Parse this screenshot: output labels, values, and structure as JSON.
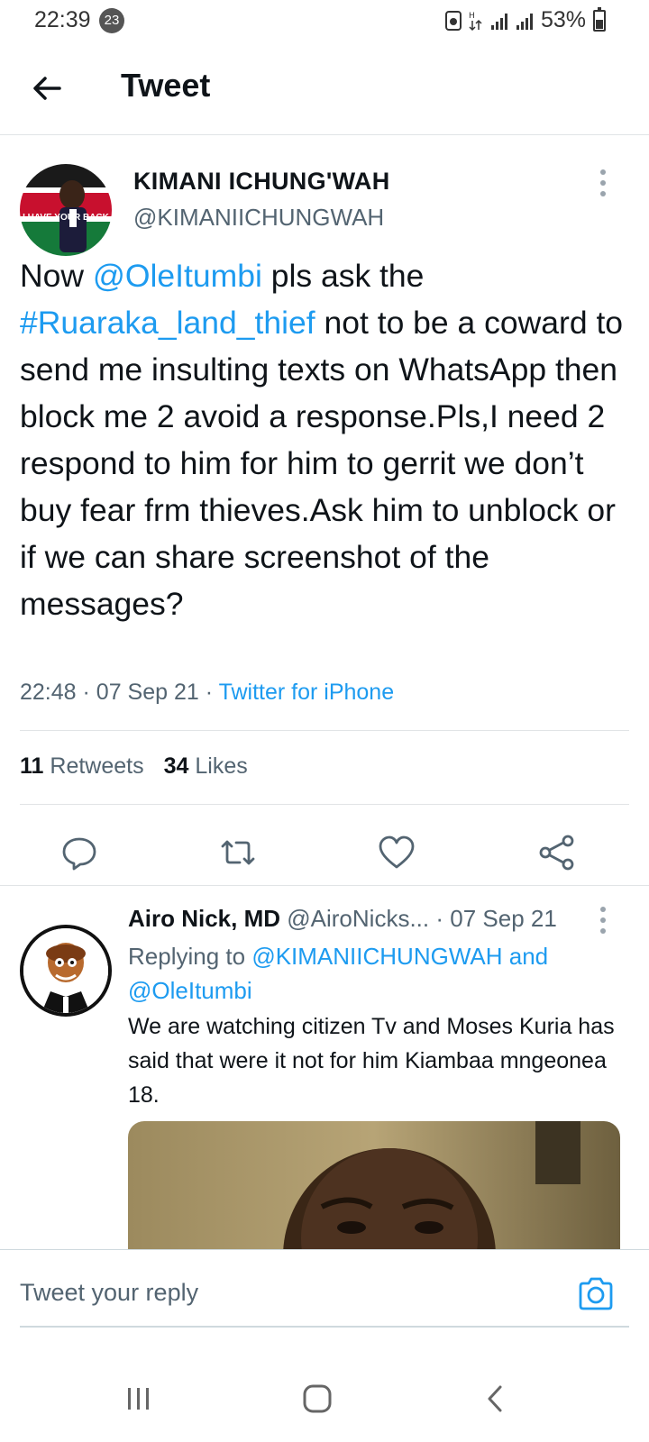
{
  "status_bar": {
    "time": "22:39",
    "notification_count": "23",
    "battery": "53%"
  },
  "header": {
    "title": "Tweet"
  },
  "main_tweet": {
    "author_name": "KIMANI ICHUNG'WAH",
    "author_handle": "@KIMANIICHUNGWAH",
    "avatar_text": "I HAVE YOUR BACK",
    "text_parts": {
      "p1": "Now ",
      "mention": "@OleItumbi",
      "p2": " pls ask the ",
      "hashtag": "#Ruaraka_land_thief",
      "p3": " not to be a coward to send me insulting texts on WhatsApp then block me 2 avoid a response.Pls,I need 2 respond to him for him to gerrit we don’t buy fear frm thieves.Ask him to unblock or if we can share screenshot of the messages?"
    },
    "time": "22:48",
    "date": "07 Sep 21",
    "source": "Twitter for iPhone",
    "retweets_count": "11",
    "retweets_label": "Retweets",
    "likes_count": "34",
    "likes_label": "Likes"
  },
  "reply": {
    "author_name": "Airo Nick, MD",
    "author_handle": "@AiroNicks...",
    "date": "07 Sep 21",
    "replying_label": "Replying to",
    "replying_to_1": "@KIMANIICHUNGWAH",
    "replying_and": "and",
    "replying_to_2": "@OleItumbi",
    "text": "We are watching citizen Tv and Moses Kuria has said that were it not for him Kiambaa mngeonea 18."
  },
  "composer": {
    "placeholder": "Tweet your reply"
  },
  "colors": {
    "link": "#1d9bf0",
    "secondary_text": "#536471",
    "divider": "#e1e4e6"
  }
}
